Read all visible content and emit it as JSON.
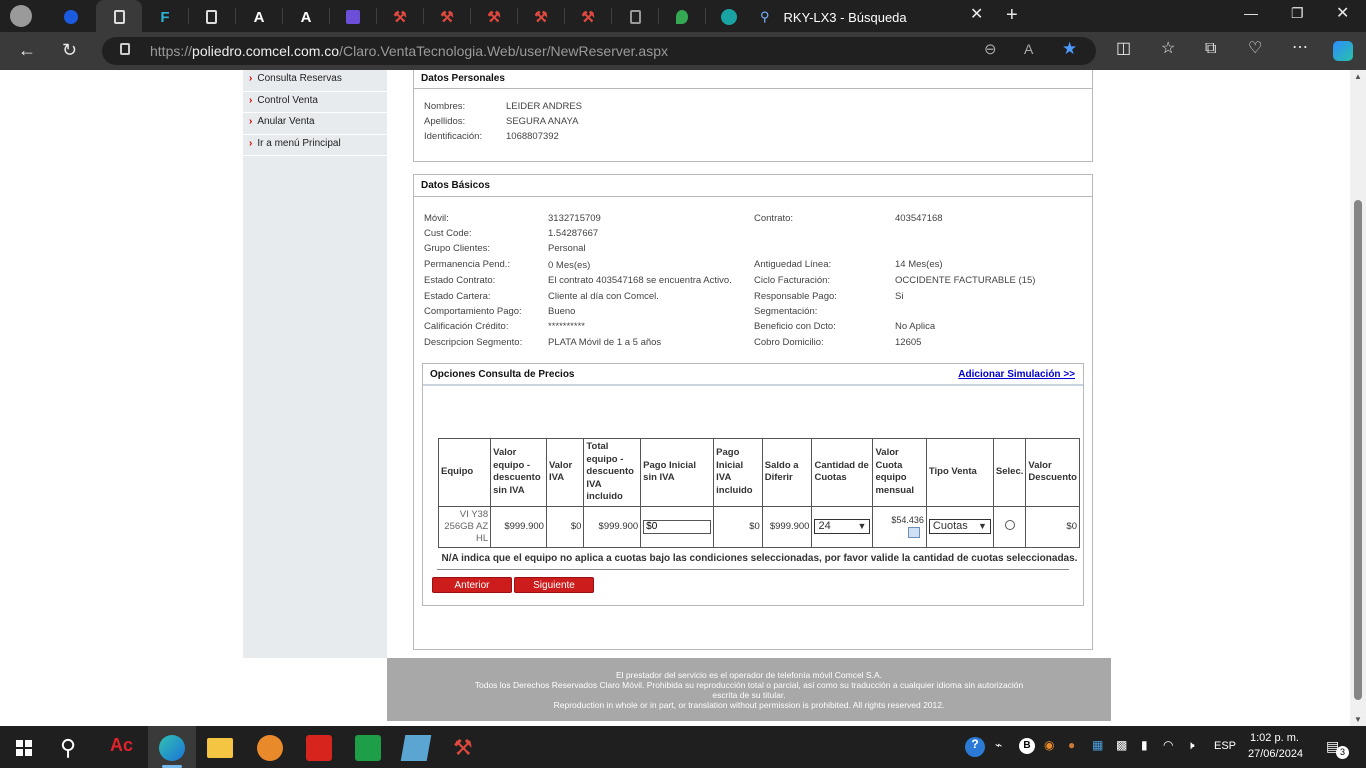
{
  "browser": {
    "active_tab_title": "RKY-LX3 - Búsqueda",
    "url_prefix": "https://",
    "url_domain": "poliedro.comcel.com.co",
    "url_path": "/Claro.VentaTecnologia.Web/user/NewReserver.aspx"
  },
  "nav": {
    "items": [
      {
        "label": "Consulta Reservas"
      },
      {
        "label": "Control Venta"
      },
      {
        "label": "Anular Venta"
      },
      {
        "label": "Ir a menú Principal"
      }
    ]
  },
  "personal": {
    "title": "Datos Personales",
    "nombres_label": "Nombres:",
    "nombres": "LEIDER ANDRES",
    "apellidos_label": "Apellidos:",
    "apellidos": "SEGURA ANAYA",
    "id_label": "Identificación:",
    "id": "1068807392"
  },
  "basicos": {
    "title": "Datos Básicos",
    "movil_label": "Móvil:",
    "movil": "3132715709",
    "contrato_label": "Contrato:",
    "contrato": "403547168",
    "cust_label": "Cust Code:",
    "cust": "1.54287667",
    "grupo_label": "Grupo Clientes:",
    "grupo": "Personal",
    "perm_label": "Permanencia Pend.:",
    "perm": "0 Mes(es)",
    "antig_label": "Antiguedad Línea:",
    "antig": "14 Mes(es)",
    "estado_label": "Estado Contrato:",
    "estado": "El contrato 403547168 se encuentra Activo.",
    "ciclo_label": "Ciclo Facturación:",
    "ciclo": "OCCIDENTE FACTURABLE (15)",
    "cartera_label": "Estado Cartera:",
    "cartera": "Cliente al día con Comcel.",
    "resp_label": "Responsable Pago:",
    "resp": "Si",
    "comp_label": "Comportamiento Pago:",
    "comp": "Bueno",
    "seg_label": "Segmentación:",
    "seg": "",
    "calif_label": "Calificación Crédito:",
    "calif": "**********",
    "benef_label": "Beneficio con Dcto:",
    "benef": "No Aplica",
    "desc_label": "Descripcion Segmento:",
    "desc": "PLATA Móvil de 1 a 5 años",
    "cobro_label": "Cobro Domicilio:",
    "cobro": "12605"
  },
  "opciones": {
    "title": "Opciones Consulta de Precios",
    "add_link": "Adicionar Simulación >>",
    "headers": [
      "Equipo",
      "Valor equipo - descuento sin IVA",
      "Valor IVA",
      "Total equipo - descuento IVA incluido",
      "Pago Inicial sin IVA",
      "Pago Inicial IVA incluido",
      "Saldo a Diferir",
      "Cantidad de Cuotas",
      "Valor Cuota equipo mensual",
      "Tipo Venta",
      "Selec.",
      "Valor Descuento"
    ],
    "row": {
      "equipo": "VI Y38 256GB AZ HL",
      "valor_sin_iva": "$999.900",
      "valor_iva": "$0",
      "total": "$999.900",
      "pago_inicial_input": "$0",
      "pago_inicial_iva": "$0",
      "saldo": "$999.900",
      "cuotas": "24",
      "cuota_mensual": "$54.436",
      "tipo_venta": "Cuotas",
      "descuento": "$0"
    },
    "note": "N/A indica que el equipo no aplica a cuotas bajo las condiciones seleccionadas, por favor valide la cantidad de cuotas seleccionadas.",
    "anterior": "Anterior",
    "siguiente": "Siguiente"
  },
  "footer": {
    "line1": "El prestador del servicio es el operador de telefonía móvil Comcel S.A.",
    "line2": "Todos los Derechos Reservados Claro Móvil. Prohibida su reproducción total o parcial, así como su traducción a cualquier idioma sin autorización",
    "line3": "escrita de su titular.",
    "line4": "Reproduction in whole or in part, or translation without permission is prohibited. All rights reserved 2012."
  },
  "taskbar": {
    "lang": "ESP",
    "time": "1:02 p. m.",
    "date": "27/06/2024",
    "notif_count": "3"
  }
}
